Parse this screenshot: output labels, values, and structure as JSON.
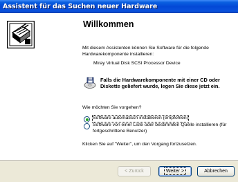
{
  "window": {
    "title": "Assistent für das Suchen neuer Hardware"
  },
  "wizard": {
    "heading": "Willkommen",
    "intro": "Mit diesem Assistenten können Sie Software für die folgende Hardwarekomponente installieren:",
    "device_name": "Miray Virtual Disk SCSI Processor Device",
    "cd_hint": "Falls die Hardwarekomponente mit einer CD oder Diskette geliefert wurde, legen Sie diese jetzt ein.",
    "question": "Wie möchten Sie vorgehen?",
    "options": [
      {
        "label": "Software automatisch installieren (empfohlen)",
        "selected": true
      },
      {
        "label": "Software von einer Liste oder bestimmten Quelle installieren (für fortgeschrittene Benutzer)",
        "selected": false
      }
    ],
    "continue_hint": "Klicken Sie auf \"Weiter\", um den Vorgang fortzusetzen."
  },
  "buttons": {
    "back": "< Zurück",
    "next": "Weiter >",
    "cancel": "Abbrechen"
  },
  "icons": {
    "wizard": "hardware-wizard-icon",
    "cd": "cd-disk-icon"
  },
  "colors": {
    "title_bar": "#0348d6",
    "radio_dot": "#21a121",
    "button_border": "#003c74"
  }
}
